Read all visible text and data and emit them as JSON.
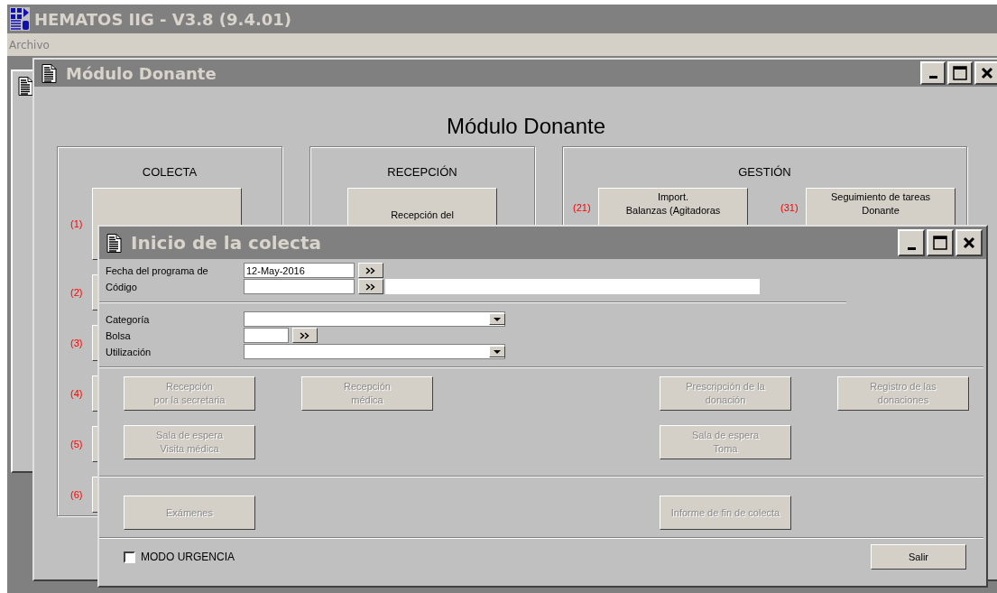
{
  "app": {
    "title": "HEMATOS IIG - V3.8 (9.4.01)",
    "menu": [
      "Archivo"
    ]
  },
  "module_window": {
    "title": "Módulo Donante",
    "heading": "Módulo Donante",
    "groups": [
      {
        "title": "COLECTA",
        "kind": "column",
        "items": [
          {
            "number": "(1)"
          },
          {
            "number": "(2)"
          },
          {
            "number": "(3)"
          },
          {
            "number": "(4)"
          },
          {
            "number": "(5)"
          },
          {
            "number": "(6)"
          }
        ]
      },
      {
        "title": "RECEPCIÓN",
        "kind": "row",
        "items": [
          {
            "label": "Recepción del"
          }
        ]
      },
      {
        "title": "GESTIÓN",
        "kind": "row",
        "items": [
          {
            "number": "(21)",
            "label": "Import.\nBalanzas (Agitadoras"
          },
          {
            "number": "(31)",
            "label": "Seguimiento de tareas\nDonante"
          }
        ]
      }
    ]
  },
  "dialog": {
    "title": "Inicio de la colecta",
    "field_groups": [
      [
        {
          "label": "Fecha del programa de",
          "kind": "lookup",
          "value": "12-May-2016"
        },
        {
          "label": "Código",
          "kind": "lookup_wide"
        }
      ],
      [
        {
          "label": "Categoría",
          "kind": "dropdown"
        },
        {
          "label": "Bolsa",
          "kind": "lookup_short"
        },
        {
          "label": "Utilización",
          "kind": "dropdown"
        }
      ]
    ],
    "button_sections": [
      [
        {
          "left": [
            {
              "label": "Recepción\npor la secretaria",
              "disabled": true
            },
            {
              "label": "Recepción\nmédica",
              "disabled": true
            }
          ],
          "right": [
            {
              "label": "Prescripción de la\ndonación",
              "disabled": true
            },
            {
              "label": "Registro de las\ndonaciones",
              "disabled": true
            }
          ]
        },
        {
          "left": [
            {
              "label": "Sala de espera\nVisita médica",
              "disabled": true
            }
          ],
          "right": [
            {
              "label": "Sala de espera\nToma",
              "disabled": true
            }
          ]
        }
      ],
      [
        {
          "left": [
            {
              "label": "Exámenes",
              "disabled": true
            }
          ],
          "right": [
            {
              "label": "Informe de fin de colecta",
              "disabled": true
            }
          ]
        }
      ]
    ],
    "emergency": {
      "label": "MODO URGENCIA",
      "checked": false
    },
    "exit_button": "Salir"
  }
}
